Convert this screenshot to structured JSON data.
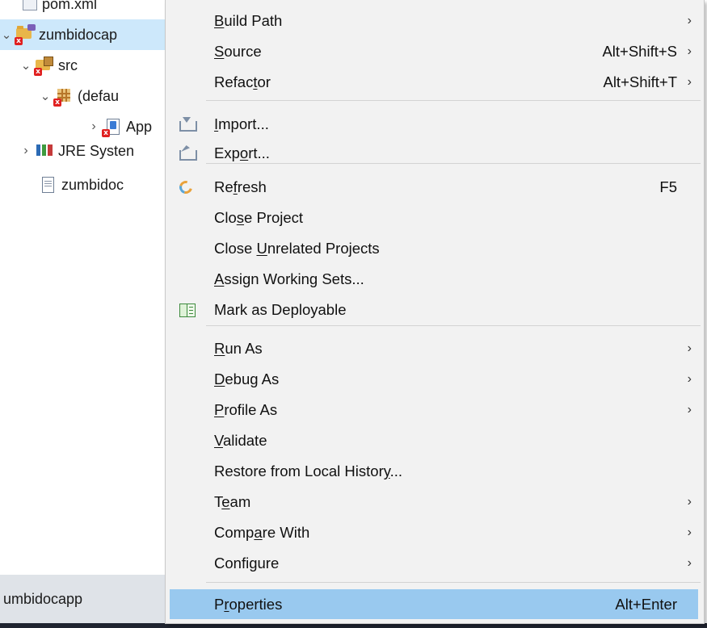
{
  "explorer": {
    "rows": [
      {
        "label": "pom.xml"
      },
      {
        "label": "zumbidocap"
      },
      {
        "label": "src"
      },
      {
        "label": "(defau"
      },
      {
        "label": "App"
      },
      {
        "label": "JRE Systen"
      },
      {
        "label": "zumbidoc"
      }
    ],
    "status_label": "umbidocapp"
  },
  "menu": {
    "items": [
      {
        "pre": "",
        "key": "B",
        "post": "uild Path",
        "shortcut": "",
        "submenu": true,
        "icon": ""
      },
      {
        "pre": "",
        "key": "S",
        "post": "ource",
        "shortcut": "Alt+Shift+S",
        "submenu": true,
        "icon": ""
      },
      {
        "pre": "Refac",
        "key": "t",
        "post": "or",
        "shortcut": "Alt+Shift+T",
        "submenu": true,
        "icon": ""
      },
      {
        "pre": "",
        "key": "I",
        "post": "mport...",
        "shortcut": "",
        "submenu": false,
        "icon": "import-icon"
      },
      {
        "pre": "Exp",
        "key": "o",
        "post": "rt...",
        "shortcut": "",
        "submenu": false,
        "icon": "export-icon"
      },
      {
        "pre": "Re",
        "key": "f",
        "post": "resh",
        "shortcut": "F5",
        "submenu": false,
        "icon": "refresh-icon"
      },
      {
        "pre": "Clo",
        "key": "s",
        "post": "e Project",
        "shortcut": "",
        "submenu": false,
        "icon": ""
      },
      {
        "pre": "Close ",
        "key": "U",
        "post": "nrelated Projects",
        "shortcut": "",
        "submenu": false,
        "icon": ""
      },
      {
        "pre": "",
        "key": "A",
        "post": "ssign Working Sets...",
        "shortcut": "",
        "submenu": false,
        "icon": ""
      },
      {
        "pre": "Mark as Deployable",
        "key": "",
        "post": "",
        "shortcut": "",
        "submenu": false,
        "icon": "deploy-icon"
      },
      {
        "pre": "",
        "key": "R",
        "post": "un As",
        "shortcut": "",
        "submenu": true,
        "icon": ""
      },
      {
        "pre": "",
        "key": "D",
        "post": "ebug As",
        "shortcut": "",
        "submenu": true,
        "icon": ""
      },
      {
        "pre": "",
        "key": "P",
        "post": "rofile As",
        "shortcut": "",
        "submenu": true,
        "icon": ""
      },
      {
        "pre": "",
        "key": "V",
        "post": "alidate",
        "shortcut": "",
        "submenu": false,
        "icon": ""
      },
      {
        "pre": "Restore from Local Histor",
        "key": "y",
        "post": "...",
        "shortcut": "",
        "submenu": false,
        "icon": ""
      },
      {
        "pre": "T",
        "key": "e",
        "post": "am",
        "shortcut": "",
        "submenu": true,
        "icon": ""
      },
      {
        "pre": "Comp",
        "key": "a",
        "post": "re With",
        "shortcut": "",
        "submenu": true,
        "icon": ""
      },
      {
        "pre": "Confi",
        "key": "g",
        "post": "ure",
        "shortcut": "",
        "submenu": true,
        "icon": ""
      },
      {
        "pre": "P",
        "key": "r",
        "post": "operties",
        "shortcut": "Alt+Enter",
        "submenu": false,
        "icon": ""
      }
    ],
    "arrow_glyph": "›"
  }
}
